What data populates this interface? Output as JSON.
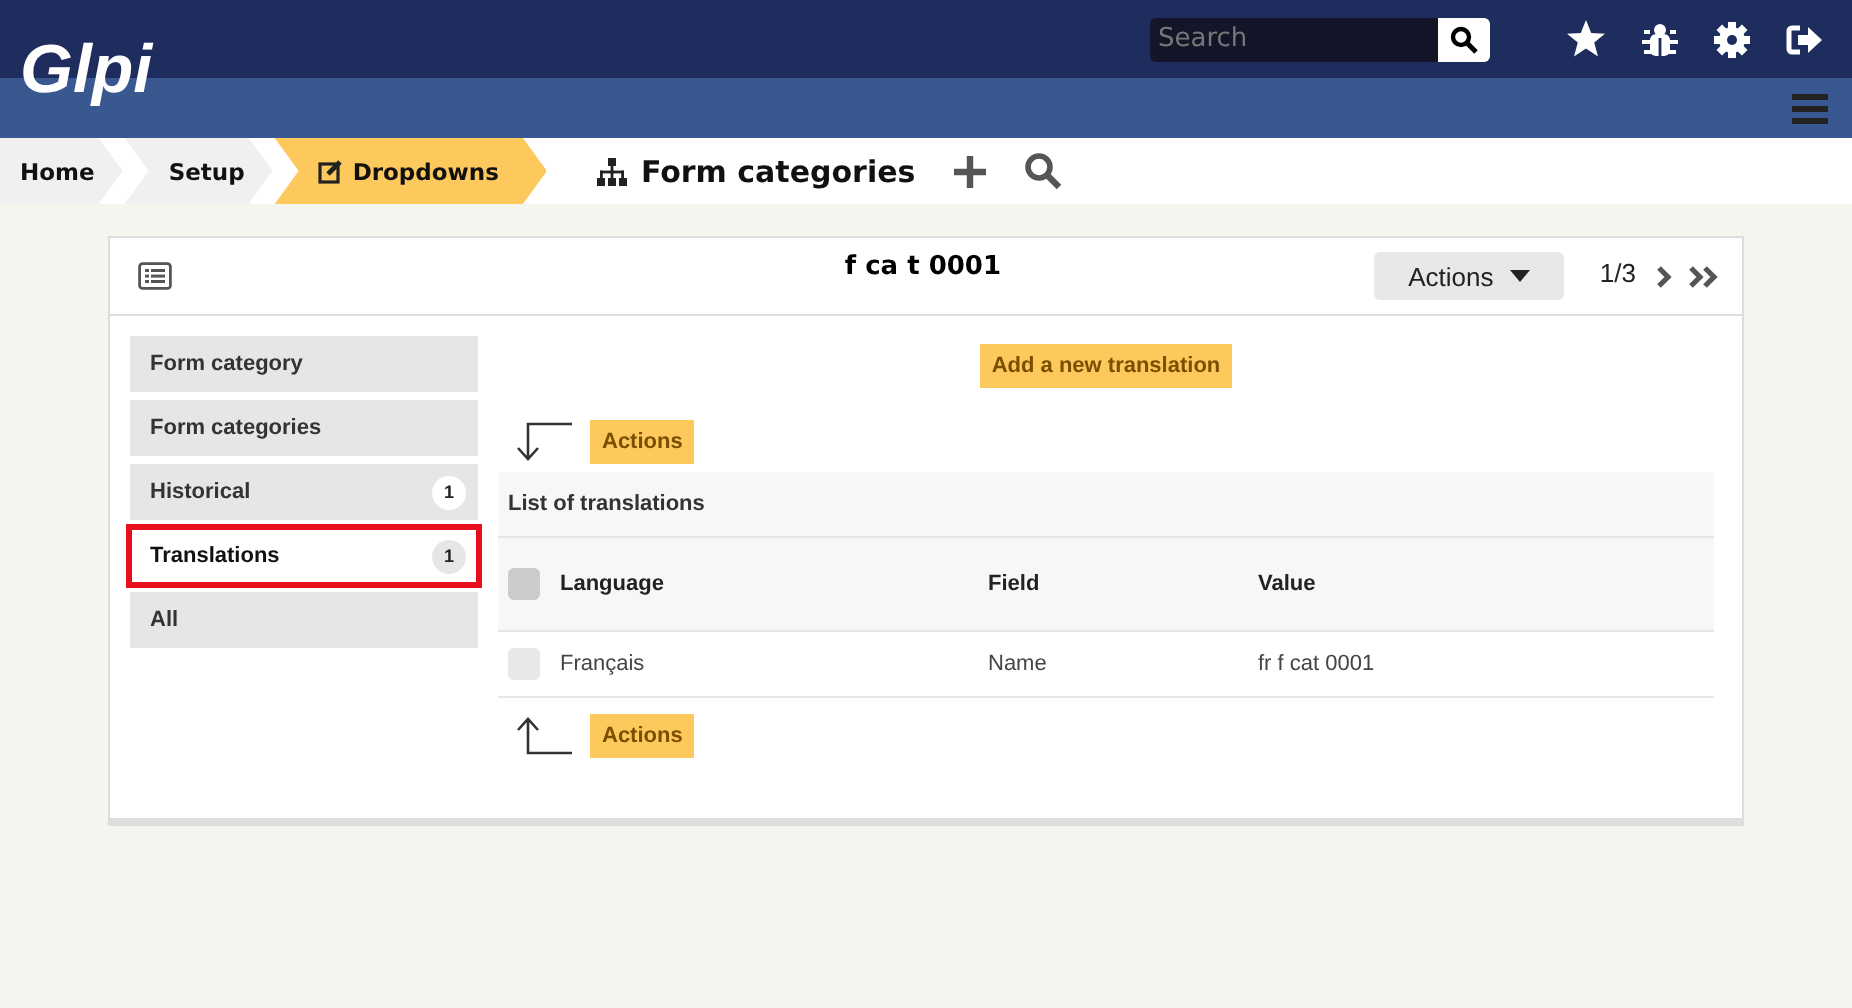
{
  "logo": "Glpi",
  "search": {
    "placeholder": "Search"
  },
  "breadcrumbs": [
    {
      "label": "Home",
      "selected": false
    },
    {
      "label": "Setup",
      "selected": false
    },
    {
      "label": "Dropdowns",
      "selected": true
    }
  ],
  "page_title": "Form categories",
  "item": {
    "title": "f ca t 0001",
    "actions": "Actions",
    "pager": "1/3"
  },
  "tabs": [
    {
      "label": "Form category",
      "selected": false
    },
    {
      "label": "Form categories",
      "selected": false
    },
    {
      "label": "Historical",
      "badge": "1",
      "selected": false
    },
    {
      "label": "Translations",
      "badge": "1",
      "selected": true
    },
    {
      "label": "All",
      "selected": false
    }
  ],
  "add_button": "Add a new translation",
  "top_actions": "Actions",
  "table": {
    "caption": "List of translations",
    "select_all_checked": false,
    "columns": [
      "Language",
      "Field",
      "Value"
    ],
    "rows": [
      {
        "checked": false,
        "cells": [
          "Français",
          "Name",
          "fr f cat 0001"
        ]
      }
    ]
  },
  "bottom_actions": "Actions"
}
